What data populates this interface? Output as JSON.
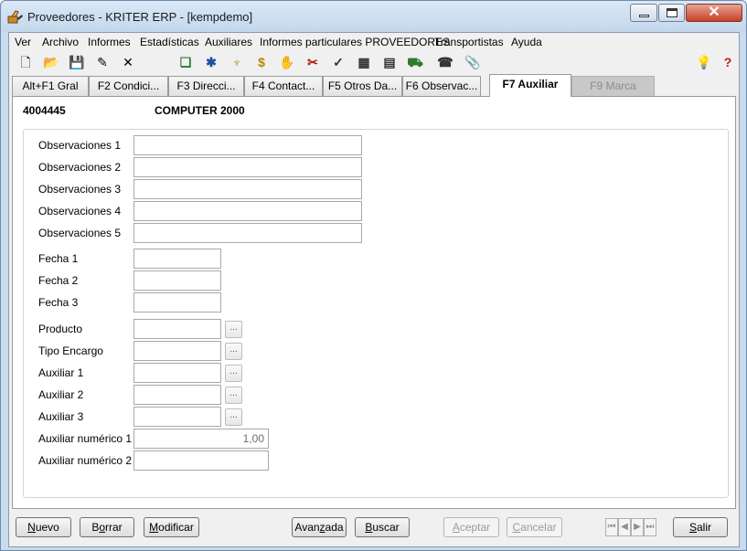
{
  "window": {
    "title": "Proveedores - KRITER ERP - [kempdemo]",
    "app_icon": "hand-pointer-icon"
  },
  "menu": [
    "Ver",
    "Archivo",
    "Informes",
    "Estadísticas",
    "Auxiliares",
    "Informes particulares PROVEEDORES",
    "Transportistas",
    "Ayuda"
  ],
  "toolbar": {
    "left": [
      {
        "name": "new-document-icon",
        "glyph": "🗋"
      },
      {
        "name": "open-folder-icon",
        "glyph": "📂"
      },
      {
        "name": "save-icon",
        "glyph": "💾"
      },
      {
        "name": "edit-icon",
        "glyph": "✎"
      },
      {
        "name": "delete-icon",
        "glyph": "✕"
      }
    ],
    "middle": [
      {
        "name": "clipboard-icon",
        "glyph": "❏"
      },
      {
        "name": "network-icon",
        "glyph": "✱"
      },
      {
        "name": "trophy-icon",
        "glyph": "♆"
      },
      {
        "name": "dollar-icon",
        "glyph": "$"
      },
      {
        "name": "hand-icon",
        "glyph": "✋"
      },
      {
        "name": "tools-icon",
        "glyph": "✂"
      },
      {
        "name": "checklist-icon",
        "glyph": "✓"
      },
      {
        "name": "table-icon",
        "glyph": "▦"
      },
      {
        "name": "document-icon",
        "glyph": "▤"
      },
      {
        "name": "truck-icon",
        "glyph": "⛟"
      },
      {
        "name": "phone-icon",
        "glyph": "☎"
      },
      {
        "name": "paperclip-icon",
        "glyph": "📎"
      }
    ],
    "right": [
      {
        "name": "lightbulb-icon",
        "glyph": "💡"
      },
      {
        "name": "help-icon",
        "glyph": "?"
      }
    ]
  },
  "tabs": [
    {
      "label": "Alt+F1 Gral",
      "state": "normal"
    },
    {
      "label": "F2 Condici...",
      "state": "normal"
    },
    {
      "label": "F3 Direcci...",
      "state": "normal"
    },
    {
      "label": "F4 Contact...",
      "state": "normal"
    },
    {
      "label": "F5 Otros Da...",
      "state": "normal"
    },
    {
      "label": "F6 Observac...",
      "state": "normal"
    },
    {
      "label": "F7 Auxiliar",
      "state": "active"
    },
    {
      "label": "F9 Marca",
      "state": "disabled"
    }
  ],
  "record": {
    "code": "4004445",
    "name": "COMPUTER 2000"
  },
  "form": {
    "observaciones": [
      {
        "label": "Observaciones 1",
        "value": ""
      },
      {
        "label": "Observaciones 2",
        "value": ""
      },
      {
        "label": "Observaciones 3",
        "value": ""
      },
      {
        "label": "Observaciones 4",
        "value": ""
      },
      {
        "label": "Observaciones 5",
        "value": ""
      }
    ],
    "fechas": [
      {
        "label": "Fecha 1",
        "value": ""
      },
      {
        "label": "Fecha 2",
        "value": ""
      },
      {
        "label": "Fecha 3",
        "value": ""
      }
    ],
    "lookups": [
      {
        "label": "Producto",
        "value": "",
        "button": "..."
      },
      {
        "label": "Tipo Encargo",
        "value": "",
        "button": "..."
      },
      {
        "label": "Auxiliar 1",
        "value": "",
        "button": "..."
      },
      {
        "label": "Auxiliar 2",
        "value": "",
        "button": "..."
      },
      {
        "label": "Auxiliar 3",
        "value": "",
        "button": "..."
      }
    ],
    "numericos": [
      {
        "label": "Auxiliar numérico 1",
        "value": "1,00"
      },
      {
        "label": "Auxiliar numérico 2",
        "value": ""
      }
    ]
  },
  "buttons": {
    "nuevo": {
      "label": "Nuevo",
      "mnemonic": "N",
      "enabled": true
    },
    "borrar": {
      "label": "Borrar",
      "mnemonic": "o",
      "enabled": true
    },
    "modificar": {
      "label": "Modificar",
      "mnemonic": "M",
      "enabled": true
    },
    "avanzada": {
      "label": "Avanzada",
      "mnemonic": "z",
      "enabled": true
    },
    "buscar": {
      "label": "Buscar",
      "mnemonic": "B",
      "enabled": true
    },
    "aceptar": {
      "label": "Aceptar",
      "mnemonic": "A",
      "enabled": false
    },
    "cancelar": {
      "label": "Cancelar",
      "mnemonic": "C",
      "enabled": false
    },
    "salir": {
      "label": "Salir",
      "mnemonic": "S",
      "enabled": true
    }
  },
  "record_nav": [
    {
      "name": "first-record-icon",
      "glyph": "⏮"
    },
    {
      "name": "previous-record-icon",
      "glyph": "◀"
    },
    {
      "name": "next-record-icon",
      "glyph": "▶"
    },
    {
      "name": "last-record-icon",
      "glyph": "⏭"
    }
  ]
}
